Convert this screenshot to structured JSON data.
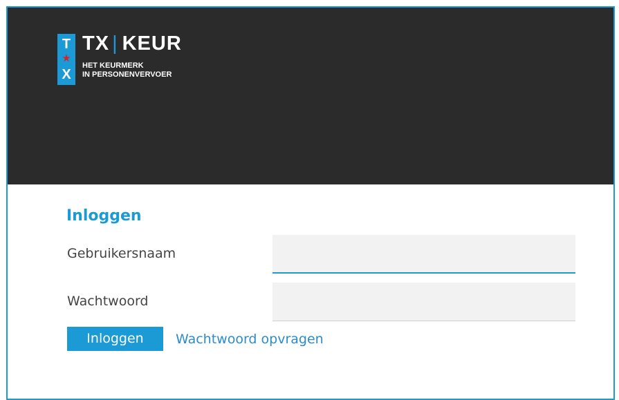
{
  "logo": {
    "badge_top": "T",
    "badge_bottom": "X",
    "brand_left": "TX",
    "brand_right": "KEUR",
    "tagline_line1": "HET KEURMERK",
    "tagline_line2": "IN PERSONENVERVOER"
  },
  "login": {
    "title": "Inloggen",
    "username_label": "Gebruikersnaam",
    "username_value": "",
    "password_label": "Wachtwoord",
    "password_value": "",
    "submit_label": "Inloggen",
    "forgot_label": "Wachtwoord opvragen"
  },
  "colors": {
    "accent": "#1b9ad6",
    "header_bg": "#2b2b2b",
    "star": "#d2232a",
    "input_bg": "#f2f2f2"
  },
  "icons": {
    "star": "star-icon"
  }
}
